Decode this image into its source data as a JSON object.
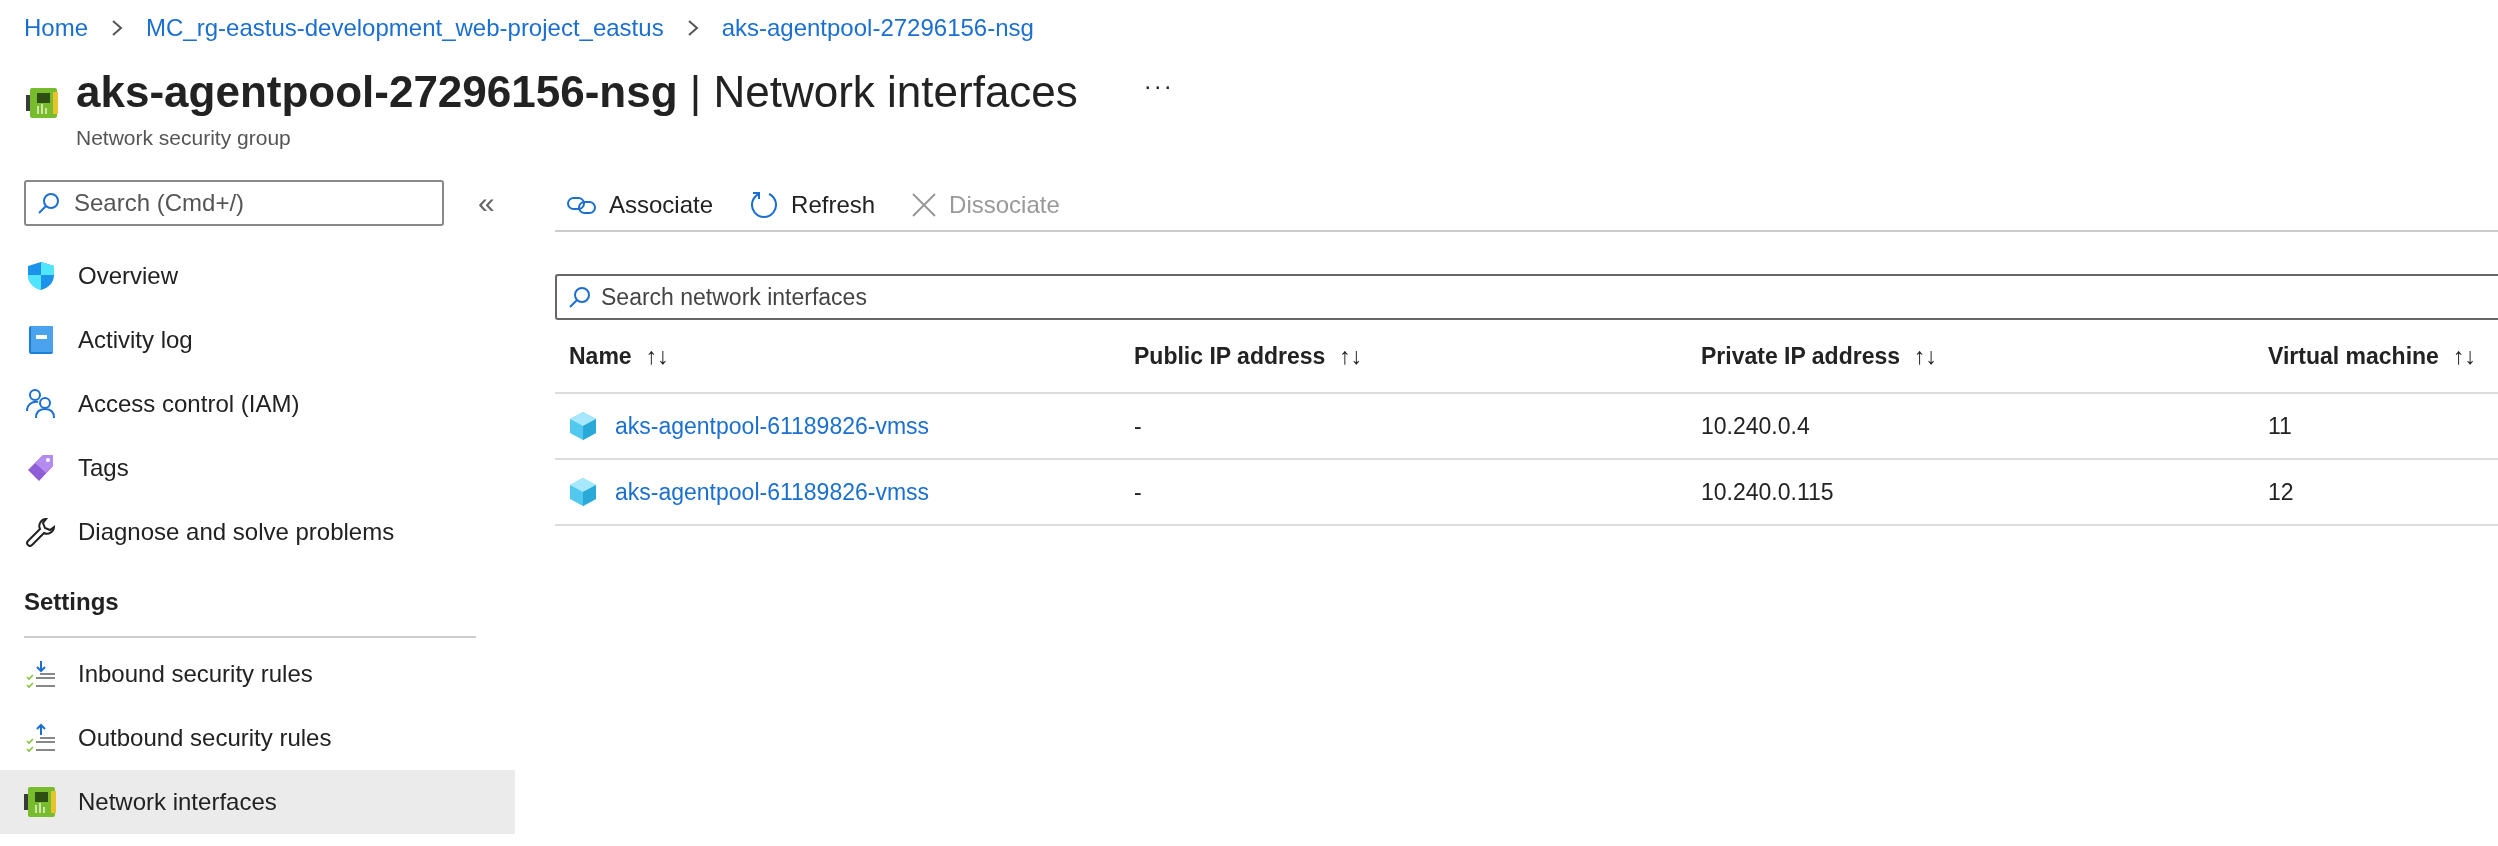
{
  "breadcrumb": [
    "Home",
    "MC_rg-eastus-development_web-project_eastus",
    "aks-agentpool-27296156-nsg"
  ],
  "header": {
    "resource": "aks-agentpool-27296156-nsg",
    "separator": "|",
    "page": "Network interfaces",
    "subtitle": "Network security group",
    "more": "···"
  },
  "sidebar": {
    "search_placeholder": "Search (Cmd+/)",
    "collapse": "«",
    "items": [
      {
        "label": "Overview",
        "selected": false
      },
      {
        "label": "Activity log",
        "selected": false
      },
      {
        "label": "Access control (IAM)",
        "selected": false
      },
      {
        "label": "Tags",
        "selected": false
      },
      {
        "label": "Diagnose and solve problems",
        "selected": false
      }
    ],
    "sections": [
      {
        "title": "Settings",
        "items": [
          {
            "label": "Inbound security rules",
            "selected": false
          },
          {
            "label": "Outbound security rules",
            "selected": false
          },
          {
            "label": "Network interfaces",
            "selected": true
          }
        ]
      }
    ]
  },
  "toolbar": [
    {
      "label": "Associate",
      "disabled": false
    },
    {
      "label": "Refresh",
      "disabled": false
    },
    {
      "label": "Dissociate",
      "disabled": true
    }
  ],
  "filter": {
    "placeholder": "Search network interfaces"
  },
  "table": {
    "sort_icon": "↑↓",
    "columns": [
      "Name",
      "Public IP address",
      "Private IP address",
      "Virtual machine"
    ],
    "rows": [
      {
        "name": "aks-agentpool-61189826-vmss",
        "public_ip": "-",
        "private_ip": "10.240.0.4",
        "vm": "11"
      },
      {
        "name": "aks-agentpool-61189826-vmss",
        "public_ip": "-",
        "private_ip": "10.240.0.115",
        "vm": "12"
      }
    ]
  }
}
